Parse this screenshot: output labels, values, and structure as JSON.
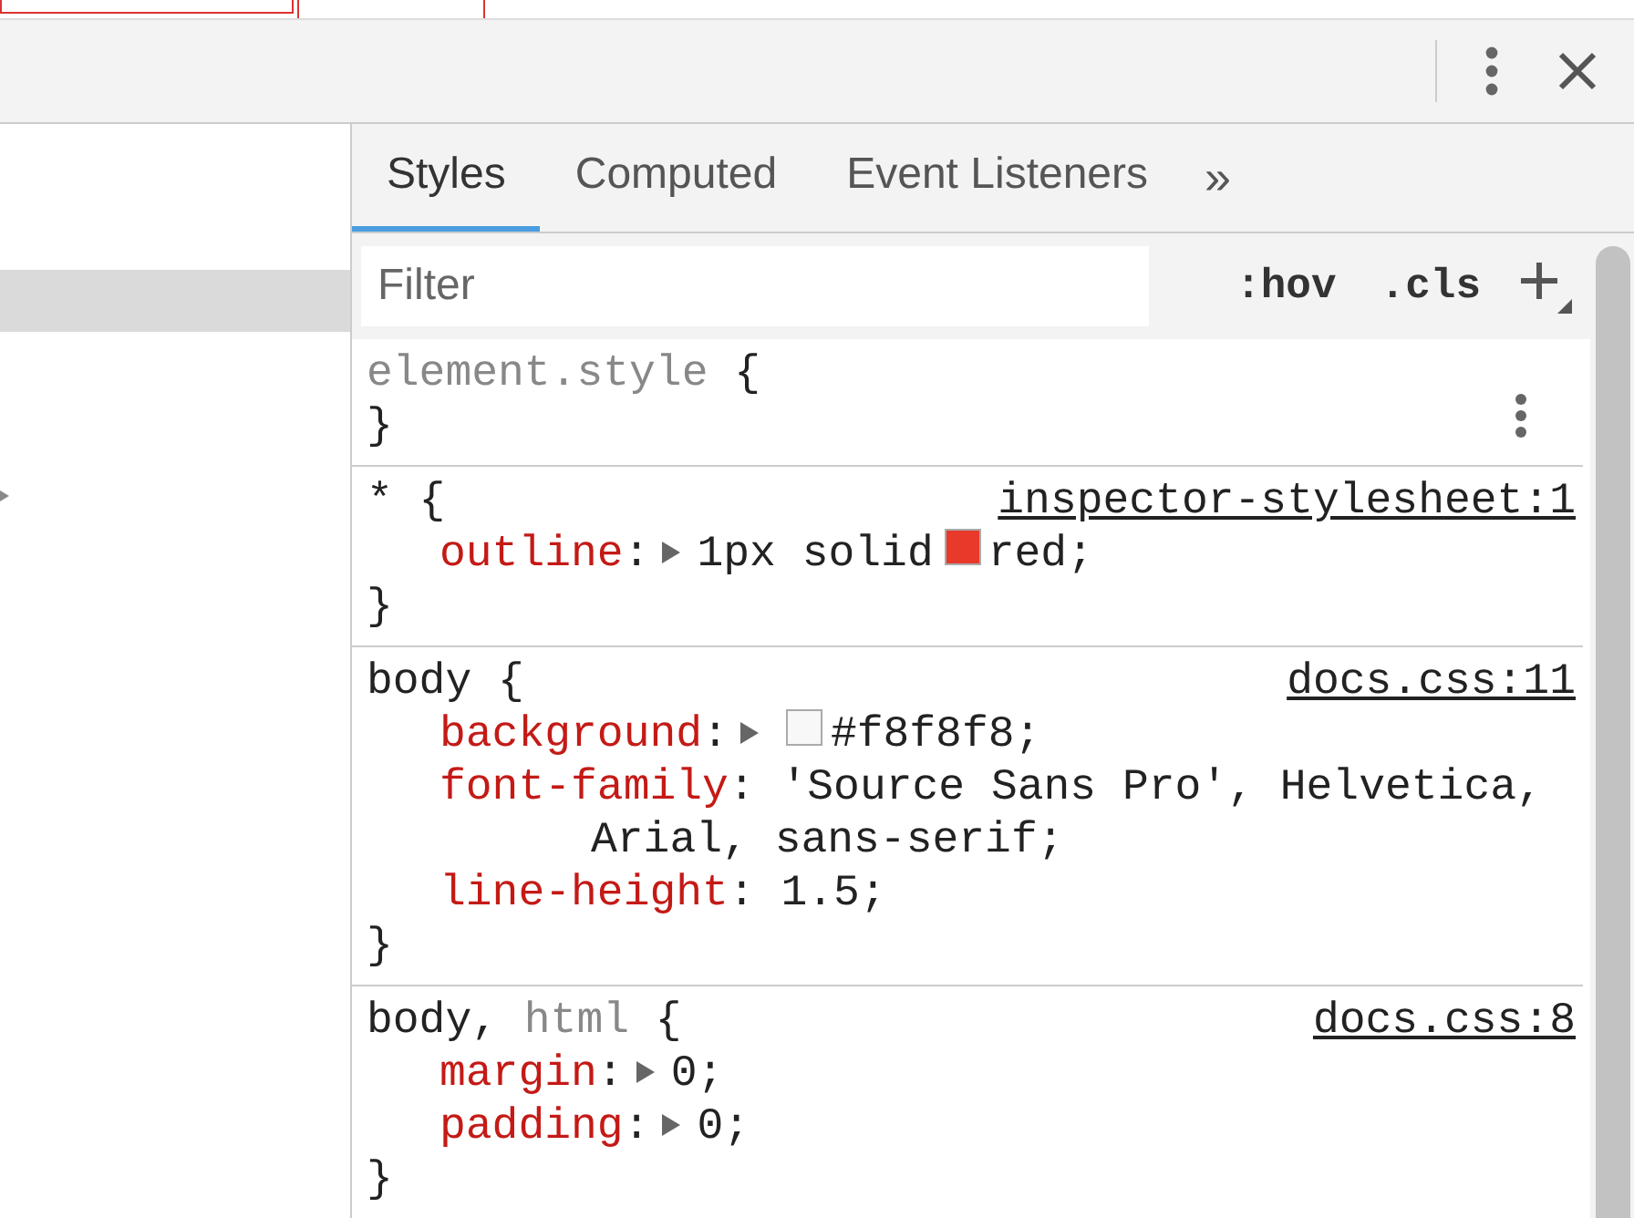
{
  "elements_rows": [
    {
      "selected": true
    }
  ],
  "tabs": [
    {
      "label": "Styles",
      "selected": true
    },
    {
      "label": "Computed",
      "selected": false
    },
    {
      "label": "Event Listeners",
      "selected": false
    }
  ],
  "more_tabs": "»",
  "filter": {
    "placeholder": "Filter"
  },
  "toggles": [
    ":hov",
    ".cls"
  ],
  "rules": [
    {
      "selectors": [
        {
          "text": "element.style",
          "matched": false
        }
      ],
      "open": "{",
      "close": "}",
      "menu": true
    },
    {
      "selectors": [
        {
          "text": "*",
          "matched": true
        }
      ],
      "open": "{",
      "close": "}",
      "source": "inspector-stylesheet:1",
      "declarations": [
        {
          "name": "outline",
          "colon": ":",
          "expandable": true,
          "prefix": "1px solid",
          "color": "#e8392b",
          "value_lines": [
            "red;"
          ]
        }
      ]
    },
    {
      "selectors": [
        {
          "text": "body",
          "matched": true
        }
      ],
      "open": "{",
      "close": "}",
      "source": "docs.css:11",
      "declarations": [
        {
          "name": "background",
          "colon": ":",
          "expandable": true,
          "color": "#f8f8f8",
          "value_lines": [
            "#f8f8f8;"
          ]
        },
        {
          "name": "font-family",
          "colon": ":",
          "expandable": false,
          "value_lines": [
            "'Source Sans Pro', Helvetica,",
            "Arial, sans-serif;"
          ]
        },
        {
          "name": "line-height",
          "colon": ":",
          "expandable": false,
          "value_lines": [
            "1.5;"
          ]
        }
      ]
    },
    {
      "selectors": [
        {
          "text": "body,",
          "matched": true
        },
        {
          "text": "html",
          "matched": false
        }
      ],
      "open": "{",
      "close": "}",
      "source": "docs.css:8",
      "declarations": [
        {
          "name": "margin",
          "colon": ":",
          "expandable": true,
          "value_lines": [
            "0;"
          ]
        },
        {
          "name": "padding",
          "colon": ":",
          "expandable": true,
          "value_lines": [
            "0;"
          ]
        }
      ]
    }
  ]
}
